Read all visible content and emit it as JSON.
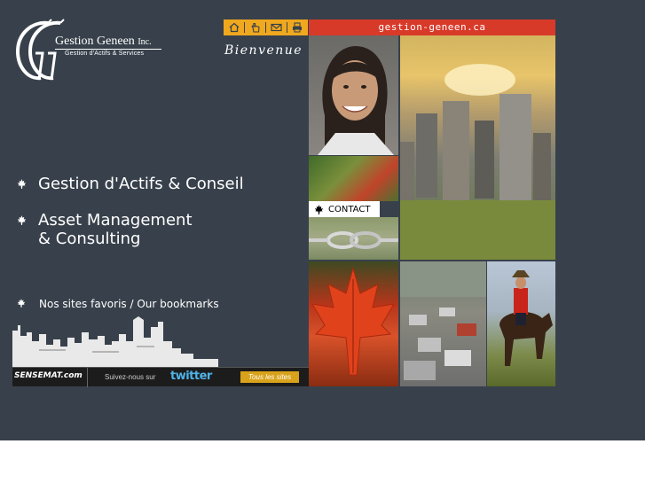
{
  "logo": {
    "company": "Gestion Geneen",
    "suffix": "Inc.",
    "tagline": "Gestion d'Actifs & Services"
  },
  "menu": {
    "items": [
      {
        "line1": "Gestion d'Actifs & Conseil"
      },
      {
        "line1": "Asset Management",
        "line2": "& Consulting"
      },
      {
        "line1": "Nos sites favoris / Our bookmarks"
      }
    ]
  },
  "toolbar": {
    "icons": [
      "home-icon",
      "hand-pointer-icon",
      "envelope-icon",
      "printer-icon"
    ],
    "url": "gestion-geneen.ca",
    "greeting": "Bienvenue"
  },
  "contact": {
    "label": "CONTACT"
  },
  "banner": {
    "brand": "SENSEMAT.com",
    "follow": "Suivez-nous sur",
    "twitter": "twitter",
    "all_sites": "Tous les sites"
  },
  "colors": {
    "background": "#38414b",
    "toolbar_orange": "#f0a81e",
    "url_red": "#d83a2a"
  }
}
